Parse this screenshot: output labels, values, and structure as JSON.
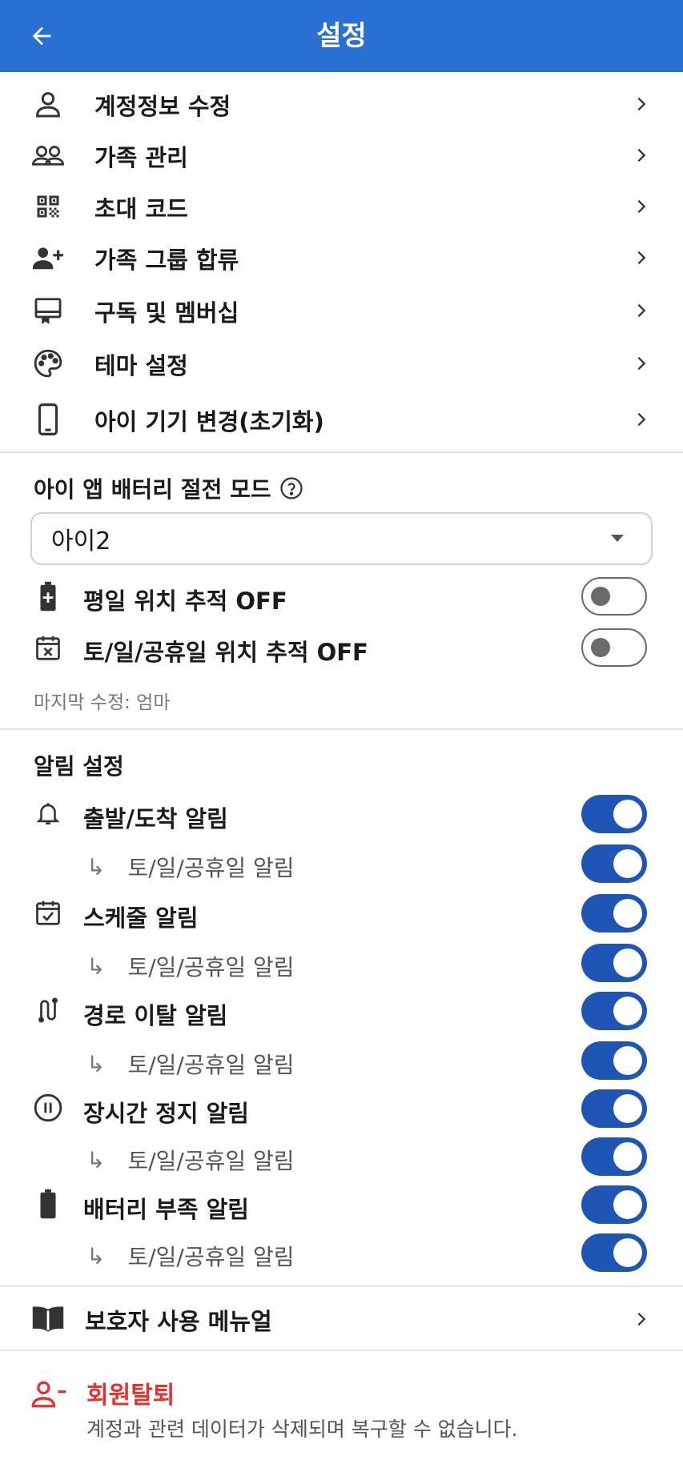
{
  "header": {
    "title": "설정"
  },
  "menu": [
    {
      "label": "계정정보 수정",
      "icon": "person-icon"
    },
    {
      "label": "가족 관리",
      "icon": "group-icon"
    },
    {
      "label": "초대 코드",
      "icon": "qr-code-icon"
    },
    {
      "label": "가족 그룹 합류",
      "icon": "person-add-icon"
    },
    {
      "label": "구독 및 멤버십",
      "icon": "membership-card-icon"
    },
    {
      "label": "테마 설정",
      "icon": "palette-icon"
    },
    {
      "label": "아이 기기 변경(초기화)",
      "icon": "smartphone-icon"
    }
  ],
  "battery_section": {
    "title": "아이 앱 배터리 절전 모드",
    "selected_child": "아이2",
    "weekday_label": "평일 위치 추적 OFF",
    "weekday_on": false,
    "weekend_label": "토/일/공휴일 위치 추적 OFF",
    "weekend_on": false,
    "last_modified": "마지막 수정: 엄마"
  },
  "notifications": {
    "title": "알림 설정",
    "sub_arrow": "↳",
    "items": [
      {
        "label": "출발/도착 알림",
        "icon": "bell-icon",
        "on": true,
        "sub_label": "토/일/공휴일 알림",
        "sub_on": true
      },
      {
        "label": "스케줄 알림",
        "icon": "calendar-check-icon",
        "on": true,
        "sub_label": "토/일/공휴일 알림",
        "sub_on": true
      },
      {
        "label": "경로 이탈 알림",
        "icon": "route-icon",
        "on": true,
        "sub_label": "토/일/공휴일 알림",
        "sub_on": true
      },
      {
        "label": "장시간 정지 알림",
        "icon": "pause-circle-icon",
        "on": true,
        "sub_label": "토/일/공휴일 알림",
        "sub_on": true
      },
      {
        "label": "배터리 부족 알림",
        "icon": "battery-icon",
        "on": true,
        "sub_label": "토/일/공휴일 알림",
        "sub_on": true
      }
    ]
  },
  "manual": {
    "label": "보호자 사용 메뉴얼",
    "icon": "book-icon"
  },
  "withdraw": {
    "label": "회원탈퇴",
    "description": "계정과 관련 데이터가 삭제되며 복구할 수 없습니다.",
    "color": "#e53030"
  },
  "colors": {
    "header": "#2a6fd4",
    "toggle_on": "#1f56b5",
    "danger": "#e53030"
  }
}
